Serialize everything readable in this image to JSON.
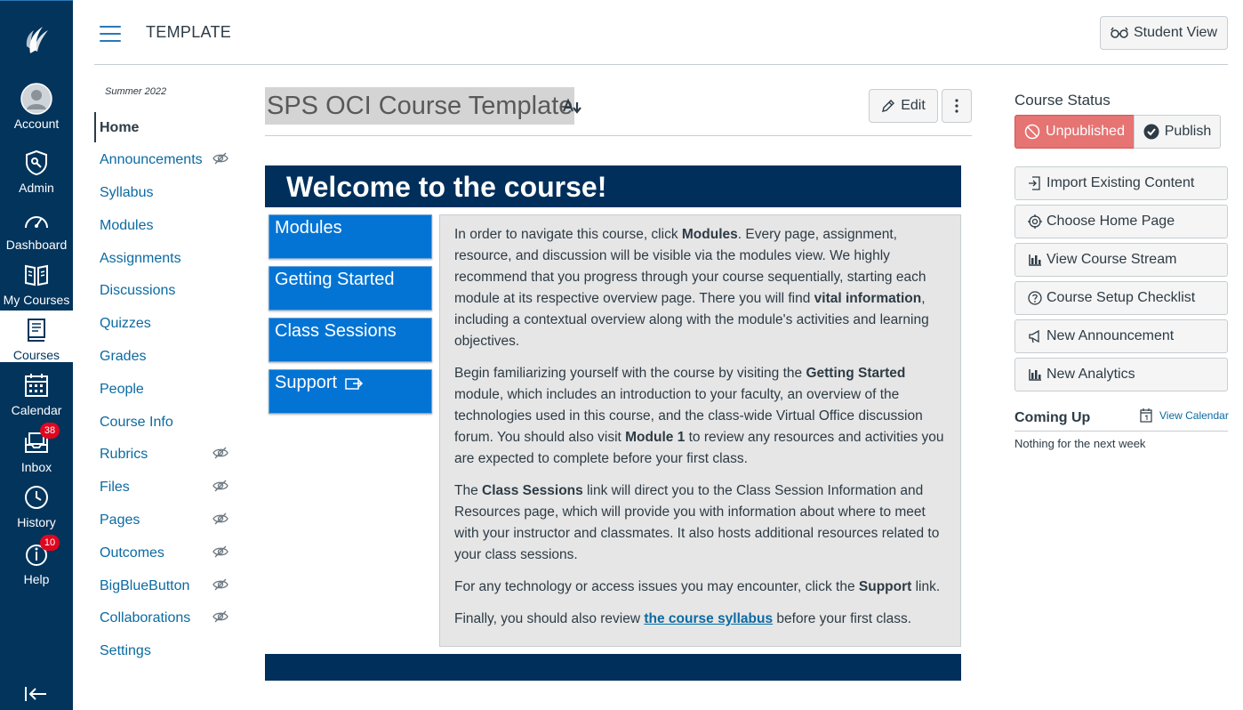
{
  "global_nav": {
    "items": [
      {
        "label": "Account",
        "icon": "account-avatar-icon"
      },
      {
        "label": "Admin",
        "icon": "admin-shield-icon"
      },
      {
        "label": "Dashboard",
        "icon": "dashboard-gauge-icon"
      },
      {
        "label": "My Courses",
        "icon": "my-courses-book-icon"
      },
      {
        "label": "Courses",
        "icon": "courses-book-icon",
        "active": true
      },
      {
        "label": "Calendar",
        "icon": "calendar-icon"
      },
      {
        "label": "Inbox",
        "icon": "inbox-icon",
        "badge": "38"
      },
      {
        "label": "History",
        "icon": "history-clock-icon"
      },
      {
        "label": "Help",
        "icon": "help-icon",
        "badge": "10"
      }
    ],
    "colors": {
      "background": "#02345c",
      "badge": "#e0061f"
    }
  },
  "header": {
    "breadcrumb": "TEMPLATE",
    "student_view": "Student View"
  },
  "course_nav": {
    "term": "Summer 2022",
    "items": [
      {
        "label": "Home",
        "active": true,
        "hidden": false
      },
      {
        "label": "Announcements",
        "hidden": true
      },
      {
        "label": "Syllabus",
        "hidden": false
      },
      {
        "label": "Modules",
        "hidden": false
      },
      {
        "label": "Assignments",
        "hidden": false
      },
      {
        "label": "Discussions",
        "hidden": false
      },
      {
        "label": "Quizzes",
        "hidden": false
      },
      {
        "label": "Grades",
        "hidden": false
      },
      {
        "label": "People",
        "hidden": false
      },
      {
        "label": "Course Info",
        "hidden": false
      },
      {
        "label": "Rubrics",
        "hidden": true
      },
      {
        "label": "Files",
        "hidden": true
      },
      {
        "label": "Pages",
        "hidden": true
      },
      {
        "label": "Outcomes",
        "hidden": true
      },
      {
        "label": "BigBlueButton",
        "hidden": true
      },
      {
        "label": "Collaborations",
        "hidden": true
      },
      {
        "label": "Settings",
        "hidden": false
      }
    ]
  },
  "page": {
    "title": "SPS OCI Course Template",
    "edit": "Edit",
    "welcome": "Welcome to the course!",
    "side_buttons": [
      "Modules",
      "Getting Started",
      "Class Sessions",
      "Support"
    ],
    "paragraphs": {
      "p1": {
        "a": "In order to navigate this course, click ",
        "b1": "Modules",
        "c": ". Every page, assignment, resource, and discussion will be visible via the modules view. We highly recommend that you progress through your course sequentially, starting each module at its respective overview page. There you will find ",
        "b2": "vital information",
        "d": ", including a contextual overview along with the module's activities and learning objectives."
      },
      "p2": {
        "a": "Begin familiarizing yourself with the course by visiting the ",
        "b1": "Getting Started",
        "c": " module, which includes an introduction to your faculty, an overview of the technologies used in this course, and the class-wide Virtual Office discussion forum. You should also visit ",
        "b2": "Module 1",
        "d": " to review any resources and activities you are expected to complete before your first class."
      },
      "p3": {
        "a": "The ",
        "b1": "Class Sessions",
        "c": " link will direct you to the Class Session Information and Resources page, which will provide you with information about where to meet with your instructor and classmates. It also hosts additional resources related to your class sessions."
      },
      "p4": {
        "a": "For any technology or access issues you may encounter, click the ",
        "b1": "Support",
        "c": " link."
      },
      "p5": {
        "a": "Finally, you should also review ",
        "link": "the course syllabus",
        "c": " before your first class."
      }
    },
    "colors": {
      "banner": "#002f5c",
      "side_button": "#0374d4",
      "content_bg": "#e6e6e6"
    }
  },
  "sidebar": {
    "course_status": "Course Status",
    "unpublished": "Unpublished",
    "publish": "Publish",
    "actions": [
      {
        "label": "Import Existing Content",
        "icon": "import-icon"
      },
      {
        "label": "Choose Home Page",
        "icon": "target-icon"
      },
      {
        "label": "View Course Stream",
        "icon": "bar-chart-icon"
      },
      {
        "label": "Course Setup Checklist",
        "icon": "question-circle-icon"
      },
      {
        "label": "New Announcement",
        "icon": "megaphone-icon"
      },
      {
        "label": "New Analytics",
        "icon": "bar-chart-icon"
      }
    ],
    "coming_up": "Coming Up",
    "view_calendar": "View Calendar",
    "nothing": "Nothing for the next week",
    "colors": {
      "unpublished_bg": "#e57473"
    }
  }
}
